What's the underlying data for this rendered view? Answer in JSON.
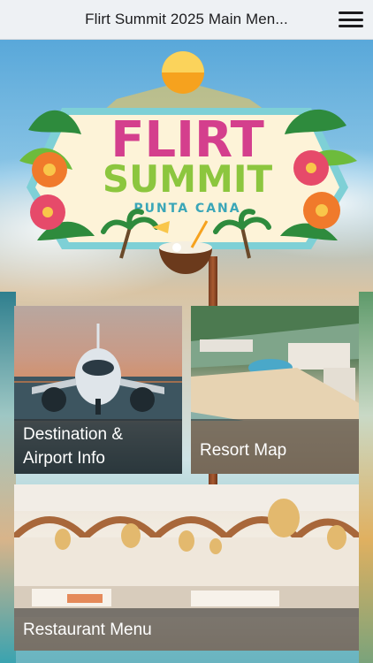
{
  "header": {
    "title": "Flirt Summit 2025 Main Men...",
    "menu_icon": "hamburger-menu-icon"
  },
  "logo": {
    "line1": "FLIRT",
    "line2": "SUMMIT",
    "line3": "PUNTA CANA",
    "colors": {
      "flirt": "#d43f8d",
      "summit": "#8cc63e",
      "punta_cana": "#3aa6b8",
      "sun": "#f6a21e"
    }
  },
  "tiles": {
    "airport": {
      "label_line1": "Destination &",
      "label_line2": "Airport Info"
    },
    "map": {
      "label": "Resort Map"
    },
    "restaurant": {
      "label": "Restaurant Menu"
    }
  }
}
